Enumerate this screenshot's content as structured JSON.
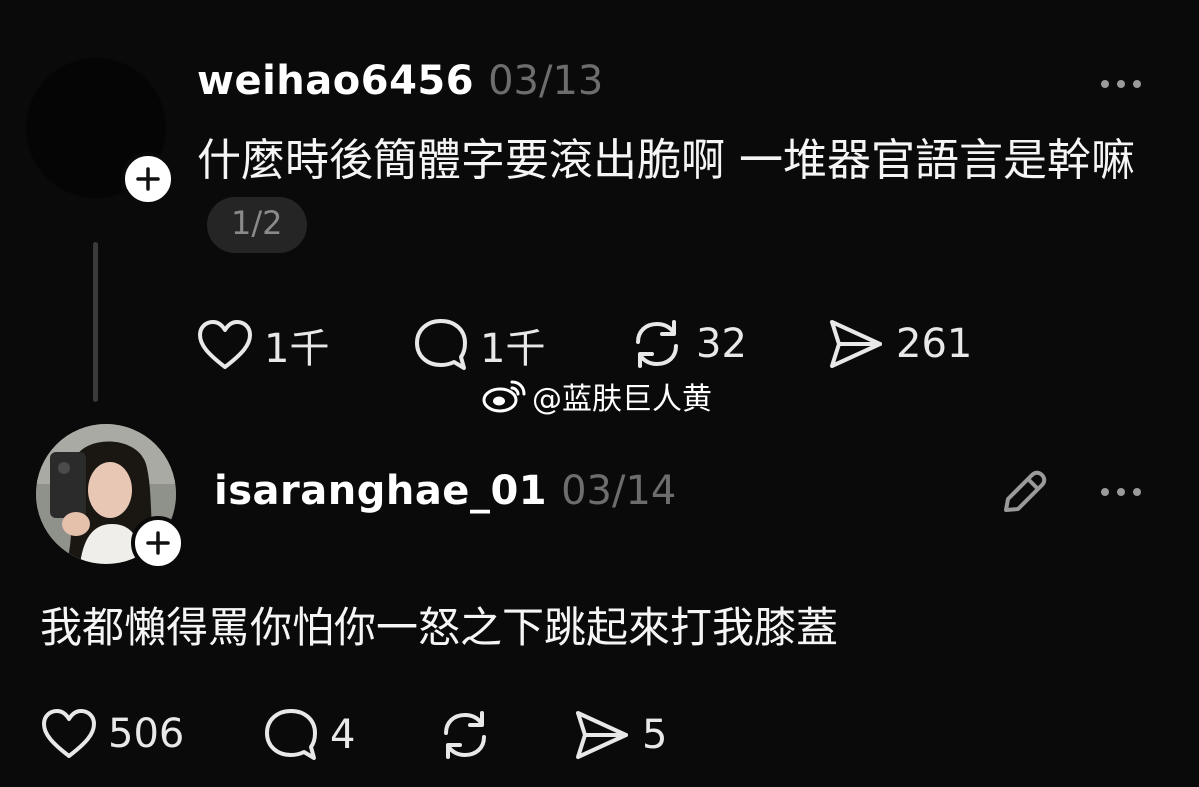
{
  "post1": {
    "username": "weihao6456",
    "date": "03/13",
    "text": "什麼時後簡體字要滾出脆啊  一堆器官語言是幹嘛",
    "page_indicator": "1/2",
    "likes": "1千",
    "comments": "1千",
    "reposts": "32",
    "shares": "261"
  },
  "watermark": {
    "text": "@蓝肤巨人黄",
    "icon": "weibo-icon"
  },
  "post2": {
    "username": "isaranghae_01",
    "date": "03/14",
    "text": "我都懶得罵你怕你一怒之下跳起來打我膝蓋",
    "likes": "506",
    "comments": "4",
    "reposts": "",
    "shares": "5"
  },
  "colors": {
    "background": "#0a0a0a",
    "text": "#f3f3f3",
    "muted": "#6d6d6d",
    "pill_bg": "#252525"
  }
}
